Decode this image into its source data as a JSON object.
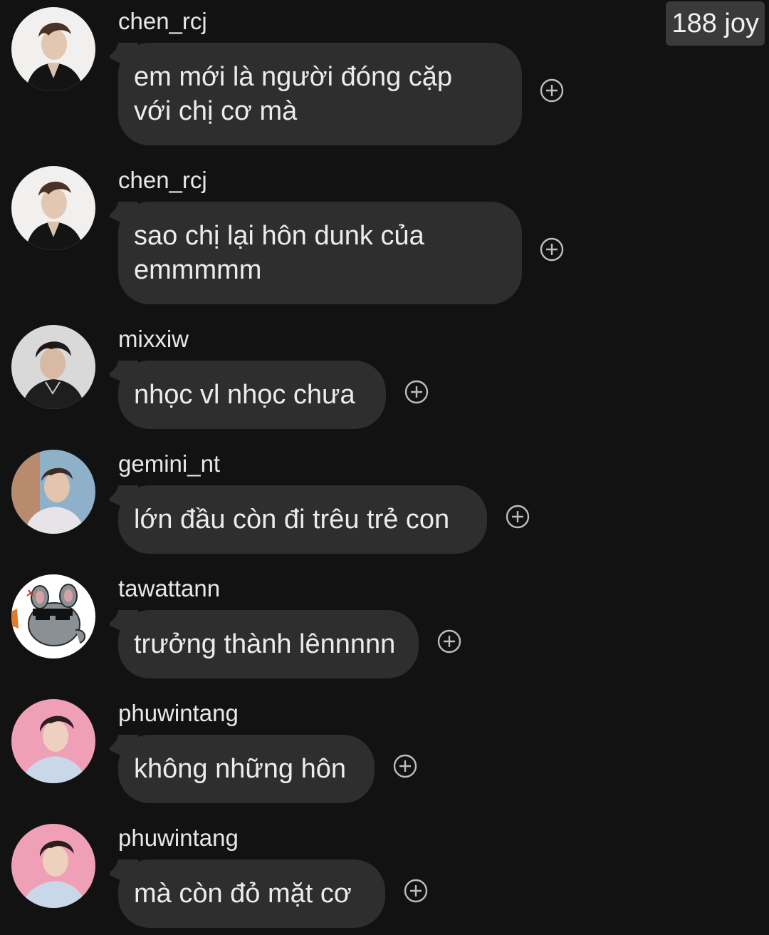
{
  "header": {
    "points_badge": "188 joy"
  },
  "messages": [
    {
      "username": "chen_rcj",
      "text_lines": [
        "em mới là người đóng cặp",
        "với chị cơ mà"
      ],
      "avatar": "avatar-chen-rcj"
    },
    {
      "username": "chen_rcj",
      "text_lines": [
        "sao chị lại hôn dunk của",
        "emmmmm"
      ],
      "avatar": "avatar-chen-rcj"
    },
    {
      "username": "mixxiw",
      "text_lines": [
        "nhọc vl nhọc chưa"
      ],
      "avatar": "avatar-mixxiw"
    },
    {
      "username": "gemini_nt",
      "text_lines": [
        "lớn đầu còn đi trêu trẻ con"
      ],
      "avatar": "avatar-gemini-nt"
    },
    {
      "username": "tawattann",
      "text_lines": [
        "trưởng thành lênnnnn"
      ],
      "avatar": "avatar-tawattann-chinchilla"
    },
    {
      "username": "phuwintang",
      "text_lines": [
        "không những hôn"
      ],
      "avatar": "avatar-phuwintang"
    },
    {
      "username": "phuwintang",
      "text_lines": [
        "mà còn đỏ mặt cơ"
      ],
      "avatar": "avatar-phuwintang"
    }
  ],
  "icons": {
    "reaction": "add-reaction-icon"
  },
  "colors": {
    "background": "#121212",
    "bubble": "#2e2e2e",
    "text": "#ececec",
    "badge": "#3a3a3a"
  }
}
